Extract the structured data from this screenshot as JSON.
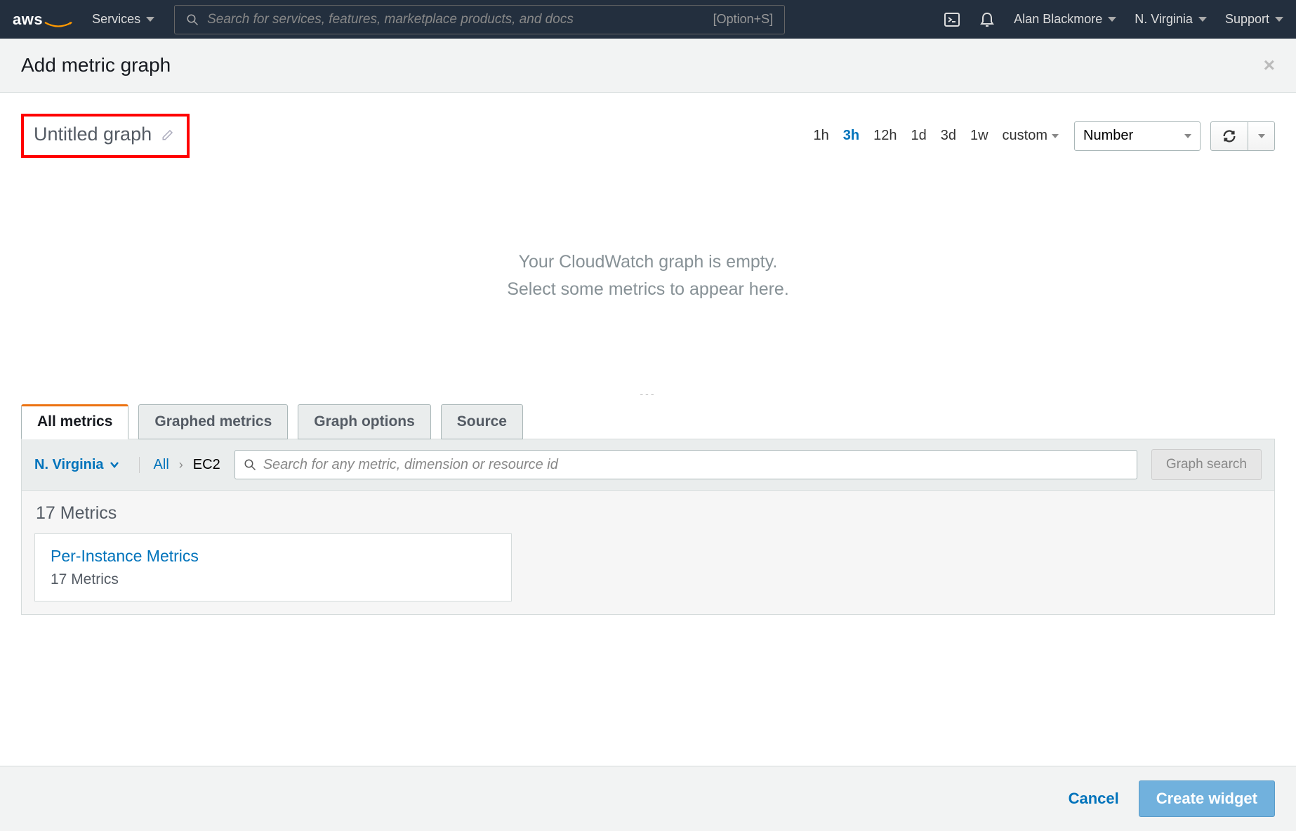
{
  "topnav": {
    "services": "Services",
    "search_placeholder": "Search for services, features, marketplace products, and docs",
    "shortcut": "[Option+S]",
    "user": "Alan Blackmore",
    "region": "N. Virginia",
    "support": "Support"
  },
  "modal": {
    "title": "Add metric graph"
  },
  "graph": {
    "title": "Untitled graph",
    "empty_line1": "Your CloudWatch graph is empty.",
    "empty_line2": "Select some metrics to appear here.",
    "drag": "---"
  },
  "time_ranges": [
    "1h",
    "3h",
    "12h",
    "1d",
    "3d",
    "1w"
  ],
  "time_active": "3h",
  "custom_label": "custom",
  "view_type": "Number",
  "tabs": [
    "All metrics",
    "Graphed metrics",
    "Graph options",
    "Source"
  ],
  "filter": {
    "region": "N. Virginia",
    "breadcrumb_all": "All",
    "breadcrumb_current": "EC2",
    "search_placeholder": "Search for any metric, dimension or resource id",
    "graph_search": "Graph search"
  },
  "metrics": {
    "count_label": "17 Metrics",
    "card_title": "Per-Instance Metrics",
    "card_sub": "17 Metrics"
  },
  "footer": {
    "cancel": "Cancel",
    "create": "Create widget"
  }
}
